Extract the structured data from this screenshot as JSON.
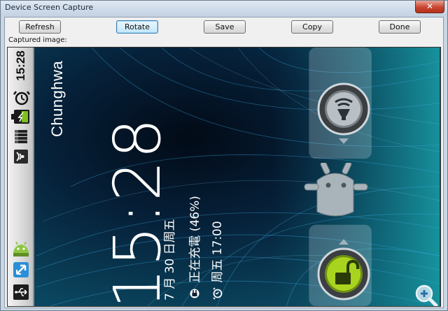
{
  "window": {
    "title": "Device Screen Capture",
    "close_glyph": "✕"
  },
  "toolbar": {
    "refresh_label": "Refresh",
    "rotate_label": "Rotate",
    "save_label": "Save",
    "copy_label": "Copy",
    "done_label": "Done"
  },
  "captured_label": "Captured image:",
  "phone": {
    "status_time": "15:28",
    "carrier": "Chunghwa",
    "lock_clock": "15:28",
    "date_text": "7 月 30 日周五",
    "charging_text": "正在充電 (46%)",
    "alarm_text": "周五 17:00",
    "icons": [
      "alarm-icon",
      "battery-charging-icon",
      "signal-icon",
      "wifi-icon",
      "android-market-icon",
      "sync-icon",
      "usb-icon",
      "sound-toggle-icon",
      "android-robot-icon",
      "unlock-icon",
      "zoom-in-icon"
    ],
    "accent_green": "#a8d420",
    "background_color": "#061a2c"
  }
}
